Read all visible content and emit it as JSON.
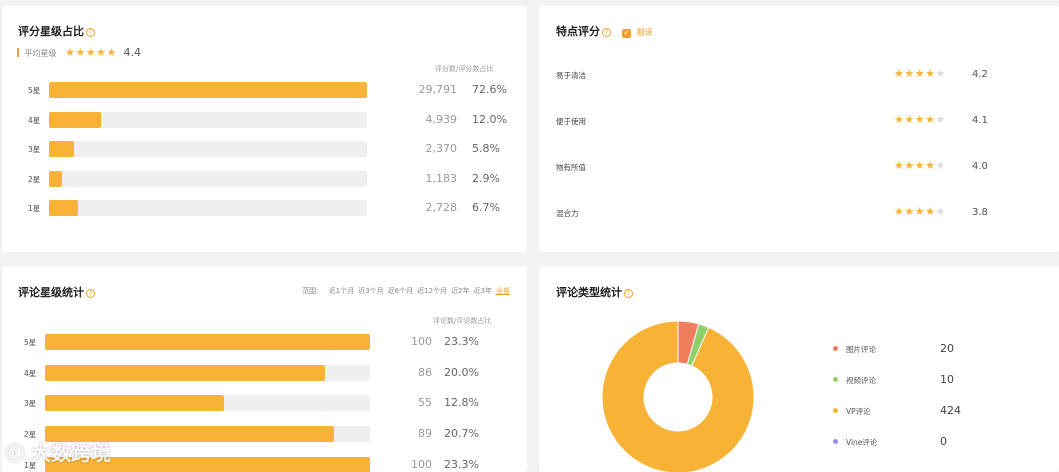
{
  "rating_share": {
    "title": "评分星级占比",
    "avg_label": "平均星级",
    "avg_value": "4.4",
    "col_header": "评分数/评分数占比",
    "rows": [
      {
        "label": "5星",
        "count": "29,791",
        "pct": "72.6%",
        "share": 1.0
      },
      {
        "label": "4星",
        "count": "4,939",
        "pct": "12.0%",
        "share": 0.165
      },
      {
        "label": "3星",
        "count": "2,370",
        "pct": "5.8%",
        "share": 0.08
      },
      {
        "label": "2星",
        "count": "1,183",
        "pct": "2.9%",
        "share": 0.04
      },
      {
        "label": "1星",
        "count": "2,728",
        "pct": "6.7%",
        "share": 0.09
      }
    ]
  },
  "features": {
    "title": "特点评分",
    "translate_label": "翻译",
    "rows": [
      {
        "label": "易于清洁",
        "score": "4.2",
        "stars_filled": 4
      },
      {
        "label": "便于使用",
        "score": "4.1",
        "stars_filled": 4
      },
      {
        "label": "物有所值",
        "score": "4.0",
        "stars_filled": 4
      },
      {
        "label": "混合力",
        "score": "3.8",
        "stars_filled": 4
      }
    ]
  },
  "review_stats": {
    "title": "评论星级统计",
    "range_label": "范围:",
    "ranges": [
      "近1个月",
      "近3个月",
      "近6个月",
      "近12个月",
      "近2年",
      "近3年",
      "全部"
    ],
    "active_range": "全部",
    "col_header": "评论数/评论数占比",
    "rows": [
      {
        "label": "5星",
        "count": "100",
        "pct": "23.3%",
        "share": 1.0
      },
      {
        "label": "4星",
        "count": "86",
        "pct": "20.0%",
        "share": 0.86
      },
      {
        "label": "3星",
        "count": "55",
        "pct": "12.8%",
        "share": 0.55
      },
      {
        "label": "2星",
        "count": "89",
        "pct": "20.7%",
        "share": 0.89
      },
      {
        "label": "1星",
        "count": "100",
        "pct": "23.3%",
        "share": 1.0
      }
    ]
  },
  "review_types": {
    "title": "评论类型统计",
    "items": [
      {
        "label": "图片评论",
        "value": "20",
        "color": "#f07c5c"
      },
      {
        "label": "视频评论",
        "value": "10",
        "color": "#8fcf6a"
      },
      {
        "label": "VP评论",
        "value": "424",
        "color": "#f8b337"
      },
      {
        "label": "Vine评论",
        "value": "0",
        "color": "#8f8fe0"
      }
    ]
  },
  "colors": {
    "accent": "#f8b337",
    "link": "#f0a030"
  },
  "watermark": "大数跨境"
}
